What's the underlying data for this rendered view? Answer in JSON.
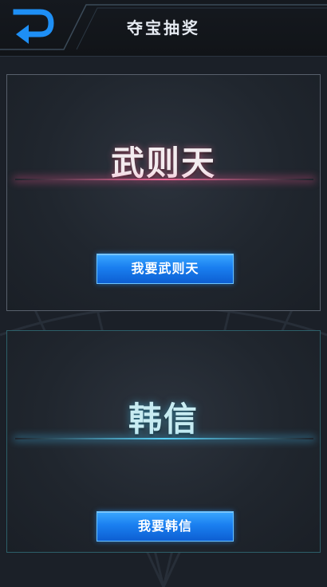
{
  "header": {
    "title": "夺宝抽奖",
    "back_icon": "back-arrow-icon"
  },
  "cards": [
    {
      "hero": "武则天",
      "button_label": "我要武则天",
      "accent": "#ff6fa0"
    },
    {
      "hero": "韩信",
      "button_label": "我要韩信",
      "accent": "#5fd4ff"
    }
  ],
  "colors": {
    "background": "#1b2028",
    "button": "#1a7ff0",
    "icon": "#1e8ff5"
  }
}
